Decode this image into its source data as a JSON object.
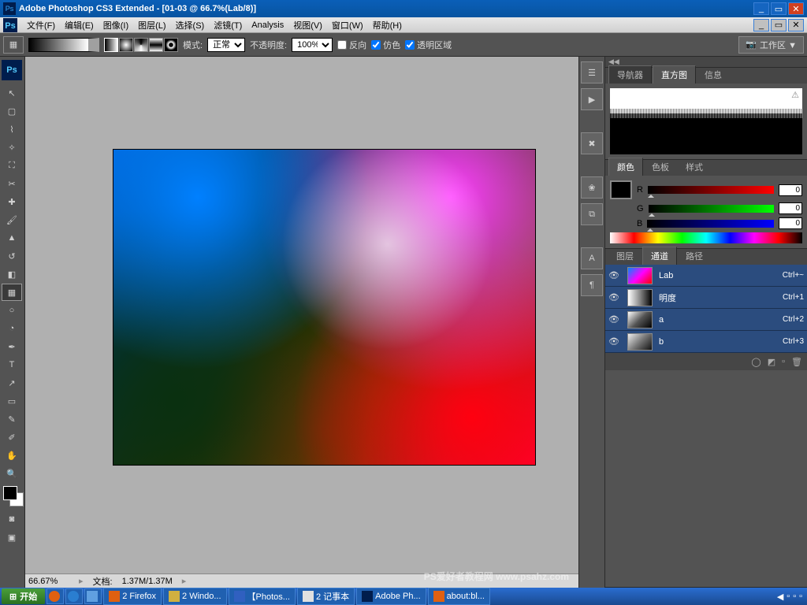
{
  "titlebar": {
    "title": "Adobe Photoshop CS3 Extended - [01-03 @ 66.7%(Lab/8)]"
  },
  "menu": {
    "file": "文件(F)",
    "edit": "编辑(E)",
    "image": "图像(I)",
    "layer": "图层(L)",
    "select": "选择(S)",
    "filter": "滤镜(T)",
    "analysis": "Analysis",
    "view": "视图(V)",
    "window": "窗口(W)",
    "help": "帮助(H)"
  },
  "options": {
    "mode_label": "模式:",
    "mode_value": "正常",
    "opacity_label": "不透明度:",
    "opacity_value": "100%",
    "reverse": "反向",
    "dither": "仿色",
    "transparency": "透明区域",
    "workspace": "工作区 ▼"
  },
  "panels": {
    "nav_tab": "导航器",
    "histogram_tab": "直方图",
    "info_tab": "信息",
    "color_tab": "颜色",
    "swatches_tab": "色板",
    "styles_tab": "样式",
    "color": {
      "r_label": "R",
      "r_val": "0",
      "g_label": "G",
      "g_val": "0",
      "b_label": "B",
      "b_val": "0"
    },
    "layers_tab": "图层",
    "channels_tab": "通道",
    "paths_tab": "路径",
    "channels": [
      {
        "name": "Lab",
        "shortcut": "Ctrl+~",
        "thumb": "lab"
      },
      {
        "name": "明度",
        "shortcut": "Ctrl+1",
        "thumb": "lum"
      },
      {
        "name": "a",
        "shortcut": "Ctrl+2",
        "thumb": "a"
      },
      {
        "name": "b",
        "shortcut": "Ctrl+3",
        "thumb": "b"
      }
    ]
  },
  "status": {
    "zoom": "66.67%",
    "doc_label": "文档:",
    "doc_size": "1.37M/1.37M"
  },
  "taskbar": {
    "start": "开始",
    "items": [
      "2 Firefox",
      "2 Windo...",
      "【Photos...",
      "2 记事本",
      "Adobe Ph...",
      "about:bl..."
    ]
  },
  "watermark": "PS爱好者教程网\nwww.psahz.com"
}
